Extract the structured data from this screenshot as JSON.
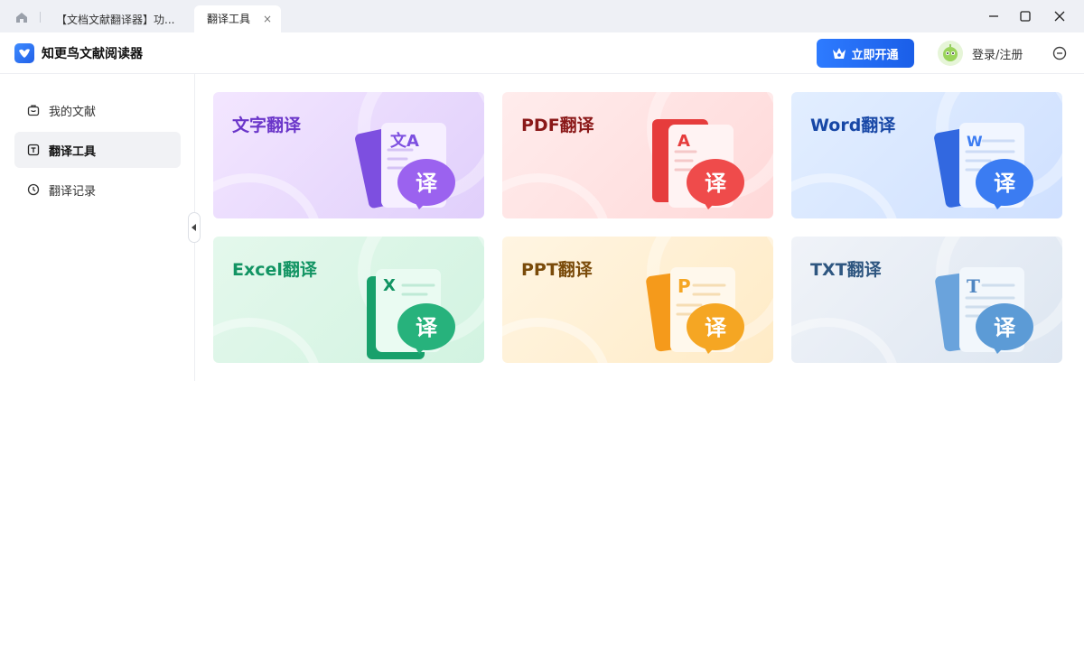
{
  "titlebar": {
    "tabs": [
      {
        "label": "【文档文献翻译器】功..."
      },
      {
        "label": "翻译工具"
      }
    ],
    "tab_close": "×"
  },
  "app": {
    "name": "知更鸟文献阅读器",
    "vip_button": "立即开通",
    "login": "登录/注册"
  },
  "sidebar": {
    "items": [
      {
        "label": "我的文献",
        "icon": "bag-icon",
        "active": false
      },
      {
        "label": "翻译工具",
        "icon": "translate-tool-icon",
        "active": true
      },
      {
        "label": "翻译记录",
        "icon": "clock-icon",
        "active": false
      }
    ]
  },
  "cards": [
    {
      "title": "文字翻译",
      "badge": "译",
      "letter": "文A",
      "title_color": "#6a35c9",
      "accent": "#9b62ef"
    },
    {
      "title": "PDF翻译",
      "badge": "译",
      "letter": "A",
      "title_color": "#8a1818",
      "accent": "#ef4b4b"
    },
    {
      "title": "Word翻译",
      "badge": "译",
      "letter": "W",
      "title_color": "#1747a6",
      "accent": "#3b7cf2"
    },
    {
      "title": "Excel翻译",
      "badge": "译",
      "letter": "X",
      "title_color": "#129463",
      "accent": "#27b27c"
    },
    {
      "title": "PPT翻译",
      "badge": "译",
      "letter": "P",
      "title_color": "#7a4b0a",
      "accent": "#f5a623"
    },
    {
      "title": "TXT翻译",
      "badge": "译",
      "letter": "T",
      "title_color": "#2e5680",
      "accent": "#5c9bd6"
    }
  ]
}
